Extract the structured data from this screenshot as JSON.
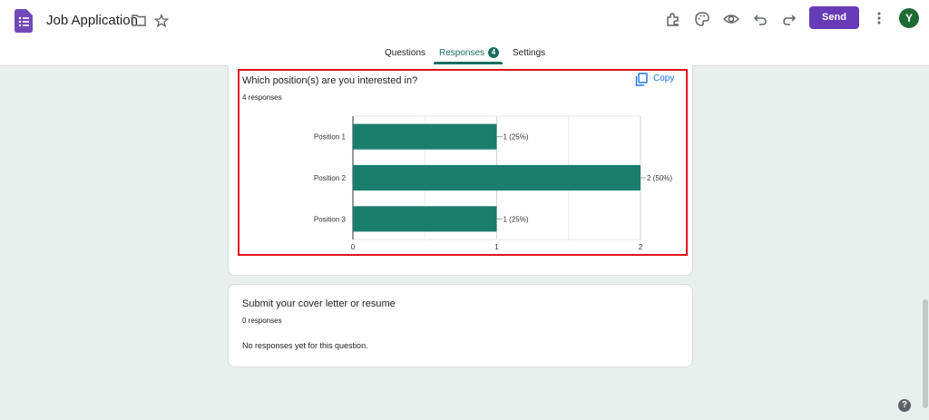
{
  "header": {
    "doc_title": "Job Application",
    "send_label": "Send",
    "avatar_initial": "Y",
    "icons": [
      "forms-logo-icon",
      "folder-icon",
      "star-icon",
      "addon-icon",
      "palette-icon",
      "preview-eye-icon",
      "undo-icon",
      "redo-icon",
      "more-vert-icon"
    ]
  },
  "tabs": [
    {
      "label": "Questions"
    },
    {
      "label": "Responses",
      "badge": "4",
      "active": true
    },
    {
      "label": "Settings"
    }
  ],
  "question1": {
    "title": "Which position(s) are you interested in?",
    "count": "4 responses",
    "copy_label": "Copy"
  },
  "question2": {
    "title": "Submit your cover letter or resume",
    "count": "0 responses",
    "empty_text": "No responses yet for this question."
  },
  "colors": {
    "accent": "#673ab7",
    "bar": "#1b7e6c",
    "highlight": "#e0141b",
    "background": "#e8f0ee"
  },
  "chart_data": {
    "type": "bar",
    "orientation": "horizontal",
    "categories": [
      "Position 1",
      "Position 2",
      "Position 3"
    ],
    "values": [
      1,
      2,
      1
    ],
    "data_labels": [
      "1 (25%)",
      "2 (50%)",
      "1 (25%)"
    ],
    "x_ticks": [
      "0",
      "1",
      "2"
    ],
    "xlim": [
      0,
      2
    ],
    "grid": true
  }
}
